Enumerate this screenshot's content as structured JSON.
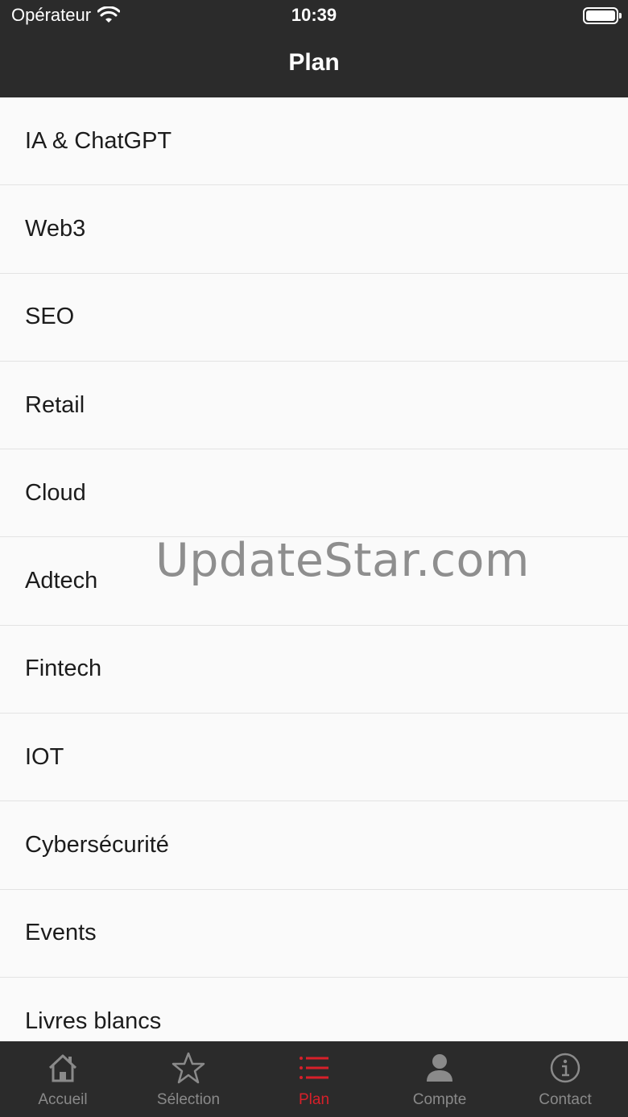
{
  "status_bar": {
    "carrier": "Opérateur",
    "time": "10:39"
  },
  "nav": {
    "title": "Plan"
  },
  "menu_items": [
    "IA & ChatGPT",
    "Web3",
    "SEO",
    "Retail",
    "Cloud",
    "Adtech",
    "Fintech",
    "IOT",
    "Cybersécurité",
    "Events",
    "Livres blancs"
  ],
  "watermark": "UpdateStar.com",
  "tabs": [
    {
      "label": "Accueil",
      "icon": "house-icon"
    },
    {
      "label": "Sélection",
      "icon": "star-icon"
    },
    {
      "label": "Plan",
      "icon": "list-icon",
      "active": true
    },
    {
      "label": "Compte",
      "icon": "person-icon"
    },
    {
      "label": "Contact",
      "icon": "info-icon"
    }
  ],
  "colors": {
    "bar_bg": "#2b2b2b",
    "accent": "#d8202a",
    "inactive": "#8a8a8a"
  }
}
